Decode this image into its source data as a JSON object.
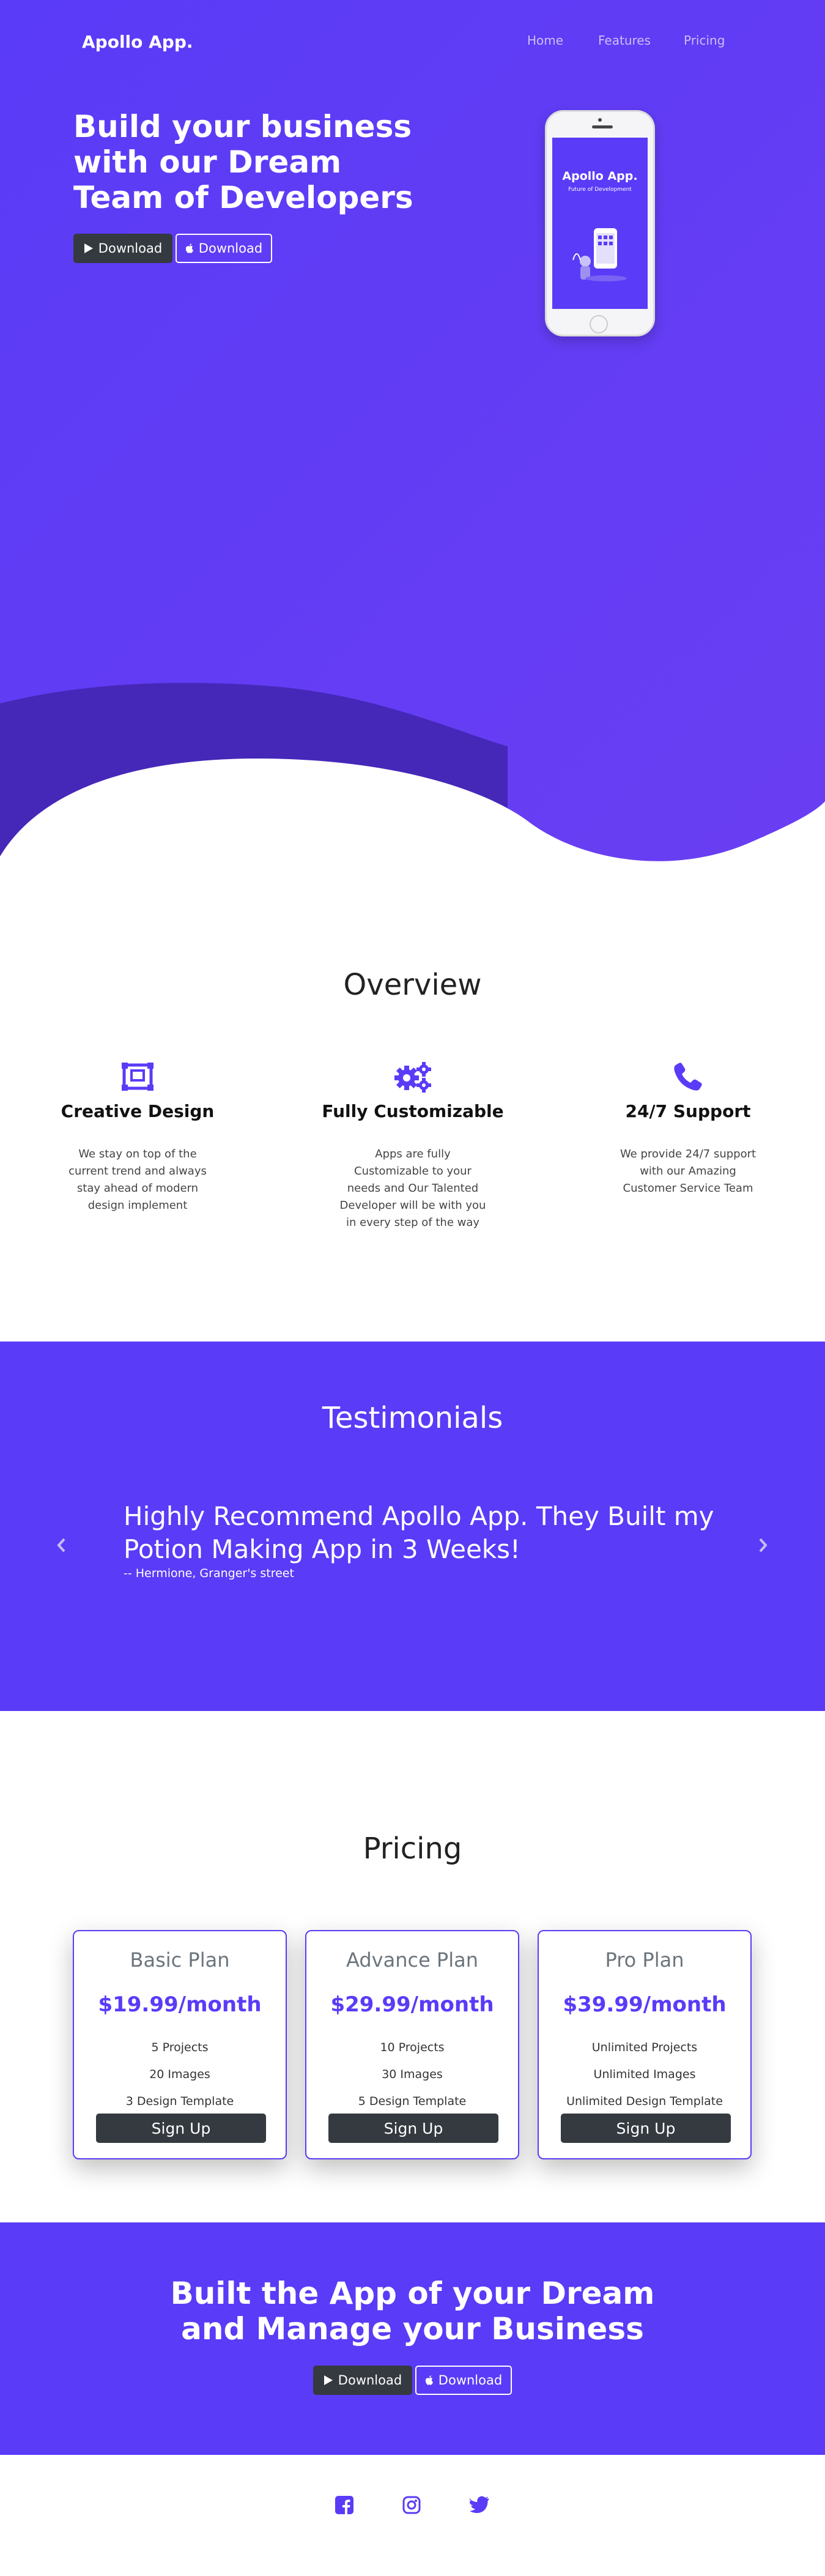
{
  "brand": "Apollo App.",
  "nav": [
    "Home",
    "Features",
    "Pricing"
  ],
  "hero": {
    "title": "Build your business with our Dream Team of Developers",
    "btn_play": "Download",
    "btn_apple": "Download",
    "phone_title": "Apollo App.",
    "phone_subtitle": "Future of Development"
  },
  "overview": {
    "title": "Overview",
    "features": [
      {
        "icon": "desktop-design-icon",
        "title": "Creative Design",
        "text": "We stay on top of the current trend and always stay ahead of modern design implement"
      },
      {
        "icon": "gears-icon",
        "title": "Fully Customizable",
        "text": "Apps are fully Customizable to your needs and Our Talented Developer will be with you in every step of the way"
      },
      {
        "icon": "phone-icon",
        "title": "24/7 Support",
        "text": "We provide 24/7 support with our Amazing Customer Service Team"
      }
    ]
  },
  "testimonials": {
    "title": "Testimonials",
    "quote": "Highly Recommend Apollo App. They Built my Potion Making App in 3 Weeks!",
    "author": "-- Hermione, Granger's street"
  },
  "pricing": {
    "title": "Pricing",
    "plans": [
      {
        "name": "Basic Plan",
        "price": "$19.99/month",
        "features": [
          "5 Projects",
          "20 Images",
          "3 Design Template"
        ],
        "button": "Sign Up"
      },
      {
        "name": "Advance Plan",
        "price": "$29.99/month",
        "features": [
          "10 Projects",
          "30 Images",
          "5 Design Template"
        ],
        "button": "Sign Up"
      },
      {
        "name": "Pro Plan",
        "price": "$39.99/month",
        "features": [
          "Unlimited Projects",
          "Unlimited Images",
          "Unlimited Design Template"
        ],
        "button": "Sign Up"
      }
    ]
  },
  "cta": {
    "title": "Built the App of your Dream and Manage your Business",
    "btn_play": "Download",
    "btn_apple": "Download"
  },
  "social": [
    "facebook-icon",
    "instagram-icon",
    "twitter-icon"
  ],
  "colors": {
    "accent": "#5a3bf7",
    "dark_button": "#343a40",
    "wave_dark": "#4528b8"
  }
}
